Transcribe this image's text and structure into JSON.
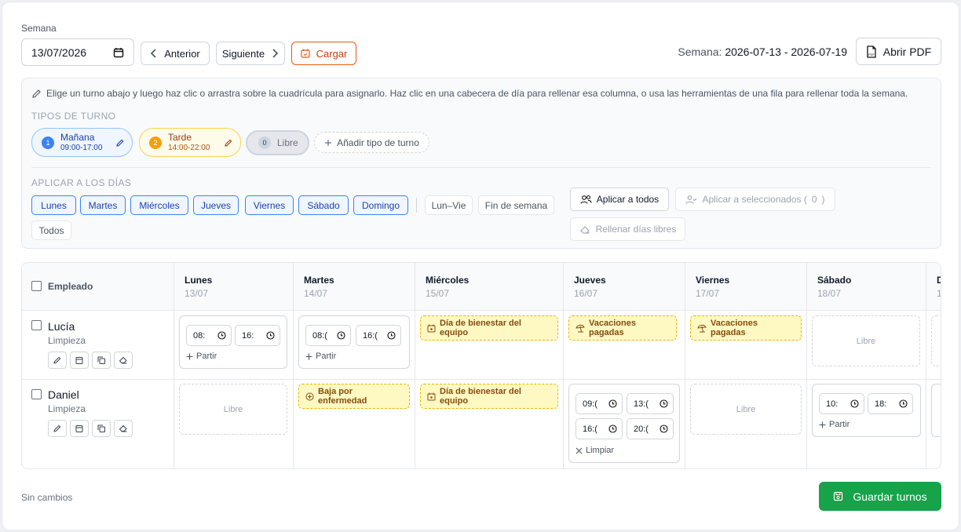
{
  "week_picker": {
    "label": "Semana",
    "date_value": "13/07/2026"
  },
  "nav": {
    "prev_label": "Anterior",
    "next_label": "Siguiente",
    "load_label": "Cargar"
  },
  "week_range": {
    "prefix": "Semana:",
    "value": "2026-07-13 - 2026-07-19"
  },
  "pdf": {
    "label": "Abrir PDF",
    "icon": "pdf-file-icon"
  },
  "tools": {
    "hint": "Elige un turno abajo y luego haz clic o arrastra sobre la cuadrícula para asignarlo. Haz clic en una cabecera de día para rellenar esa columna, o usa las herramientas de una fila para rellenar toda la semana.",
    "shift_types_title": "TIPOS DE TURNO",
    "shift_types": [
      {
        "num": "1",
        "name": "Mañana",
        "hours": "09:00-17:00",
        "color": "#3b82f6"
      },
      {
        "num": "2",
        "name": "Tarde",
        "hours": "14:00-22:00",
        "color": "#f59e0b"
      },
      {
        "num": "0",
        "name": "Libre"
      }
    ],
    "add_type_label": "Añadir tipo de turno",
    "apply_days_title": "APLICAR A LOS DÍAS",
    "days": [
      "Lunes",
      "Martes",
      "Miércoles",
      "Jueves",
      "Viernes",
      "Sábado",
      "Domingo"
    ],
    "presets": [
      "Lun–Vie",
      "Fin de semana",
      "Todos"
    ],
    "apply_all_label": "Aplicar a todos",
    "apply_selected_label": "Aplicar a seleccionados (",
    "apply_selected_count": "0",
    "apply_selected_close": ")",
    "fill_free_label": "Rellenar días libres"
  },
  "grid": {
    "employee_header": "Empleado",
    "columns": [
      {
        "day": "Lunes",
        "date": "13/07"
      },
      {
        "day": "Martes",
        "date": "14/07"
      },
      {
        "day": "Miércoles",
        "date": "15/07"
      },
      {
        "day": "Jueves",
        "date": "16/07"
      },
      {
        "day": "Viernes",
        "date": "17/07"
      },
      {
        "day": "Sábado",
        "date": "18/07"
      },
      {
        "day": "D",
        "date": "1"
      }
    ],
    "rows": [
      {
        "name": "Lucía",
        "role": "Limpieza",
        "cells": [
          {
            "type": "shift",
            "times": [
              "08:",
              "16:"
            ],
            "action": "Partir"
          },
          {
            "type": "shift",
            "times": [
              "08:(",
              "16:("
            ],
            "action": "Partir"
          },
          {
            "type": "absence",
            "label": "Día de bienestar del equipo"
          },
          {
            "type": "absence",
            "label": "Vacaciones pagadas"
          },
          {
            "type": "absence",
            "label": "Vacaciones pagadas"
          },
          {
            "type": "libre",
            "label": "Libre"
          }
        ]
      },
      {
        "name": "Daniel",
        "role": "Limpieza",
        "cells": [
          {
            "type": "libre",
            "label": "Libre"
          },
          {
            "type": "absence",
            "label": "Baja por enfermedad"
          },
          {
            "type": "absence",
            "label": "Día de bienestar del equipo"
          },
          {
            "type": "split",
            "times": [
              "09:(",
              "13:(",
              "16:(",
              "20:("
            ],
            "action": "Limpiar"
          },
          {
            "type": "libre",
            "label": "Libre"
          },
          {
            "type": "shift",
            "times": [
              "10:",
              "18:"
            ],
            "action": "Partir"
          }
        ]
      }
    ]
  },
  "footer": {
    "status": "Sin cambios",
    "save_label": "Guardar turnos"
  },
  "colors": {
    "accent_orange": "#ea580c",
    "save_green": "#16a34a",
    "day_blue": "#3b82f6",
    "absence_yellow": "#fef9c3"
  }
}
